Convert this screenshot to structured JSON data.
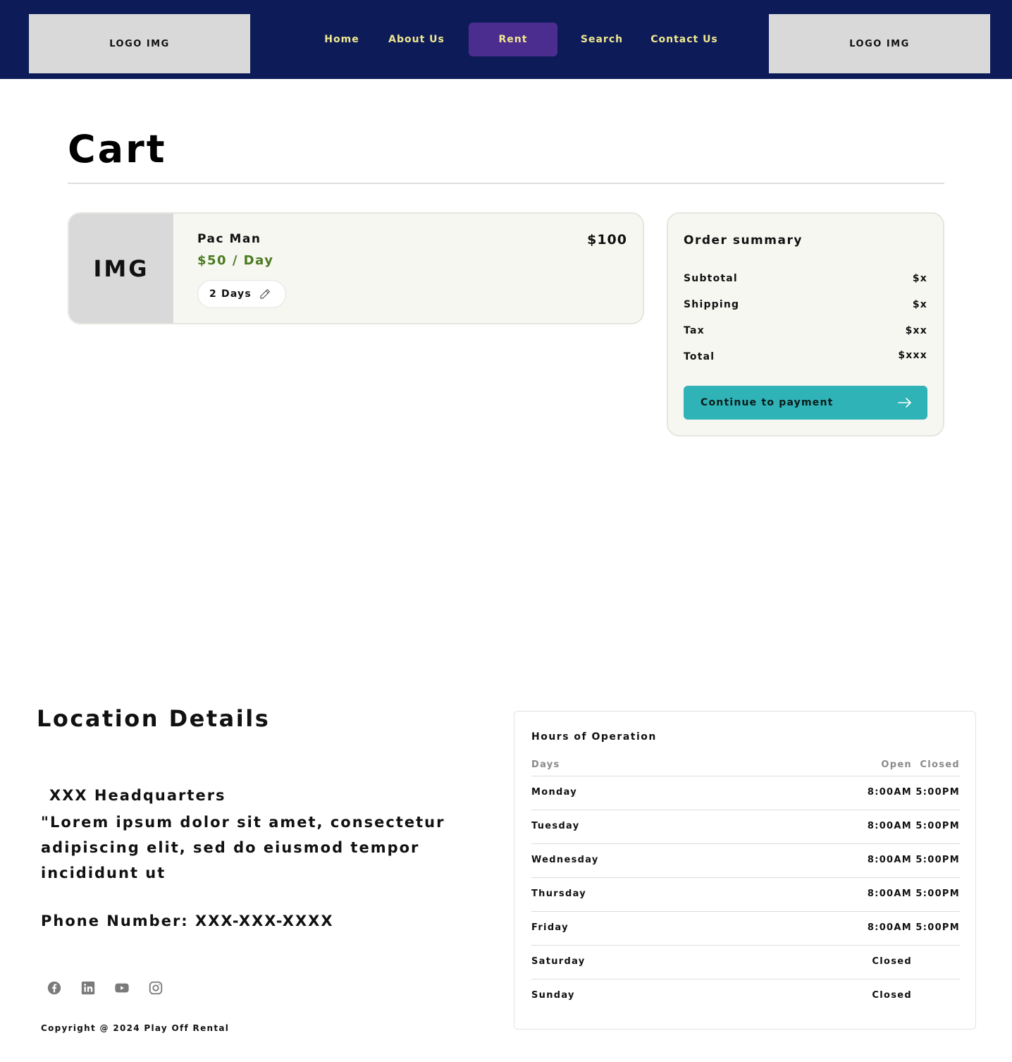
{
  "header": {
    "logo_left": "LOGO IMG",
    "logo_right": "LOGO IMG",
    "nav": [
      {
        "label": "Home"
      },
      {
        "label": "About Us"
      },
      {
        "label": "Rent"
      },
      {
        "label": "Search"
      },
      {
        "label": "Contact Us"
      }
    ],
    "active_nav": "Rent",
    "colors": {
      "background": "#0d1c58",
      "nav_text": "#f1e891",
      "active": "#4b2d8f"
    }
  },
  "cart": {
    "title": "Cart",
    "items": [
      {
        "image_label": "IMG",
        "name": "Pac Man",
        "rate": "$50 / Day",
        "price": "$100",
        "days": "2 Days"
      }
    ]
  },
  "summary": {
    "title": "Order summary",
    "rows": [
      {
        "label": "Subtotal",
        "value": "$x"
      },
      {
        "label": "Shipping",
        "value": "$x"
      },
      {
        "label": "Tax",
        "value": "$xx"
      },
      {
        "label": "Total",
        "value": "$xxx"
      }
    ],
    "button_label": "Continue to payment",
    "button_color": "#2fb3b6"
  },
  "location": {
    "title": "Location Details",
    "headquarters": "XXX Headquarters",
    "description": "\"Lorem ipsum dolor sit amet, consectetur adipiscing elit, sed do eiusmod tempor incididunt ut",
    "phone": "Phone Number: XXX-XXX-XXXX",
    "socials": [
      "facebook-icon",
      "linkedin-icon",
      "youtube-icon",
      "instagram-icon"
    ],
    "copyright": "Copyright @ 2024 Play Off Rental"
  },
  "hours": {
    "title": "Hours of Operation",
    "headers": {
      "days": "Days",
      "open": "Open",
      "closed": "Closed"
    },
    "rows": [
      {
        "day": "Monday",
        "open": "8:00AM",
        "closed": "5:00PM"
      },
      {
        "day": "Tuesday",
        "open": "8:00AM",
        "closed": "5:00PM"
      },
      {
        "day": "Wednesday",
        "open": "8:00AM",
        "closed": "5:00PM"
      },
      {
        "day": "Thursday",
        "open": "8:00AM",
        "closed": "5:00PM"
      },
      {
        "day": "Friday",
        "open": "8:00AM",
        "closed": "5:00PM"
      },
      {
        "day": "Saturday",
        "open": "Closed",
        "closed": ""
      },
      {
        "day": "Sunday",
        "open": "Closed",
        "closed": ""
      }
    ]
  }
}
